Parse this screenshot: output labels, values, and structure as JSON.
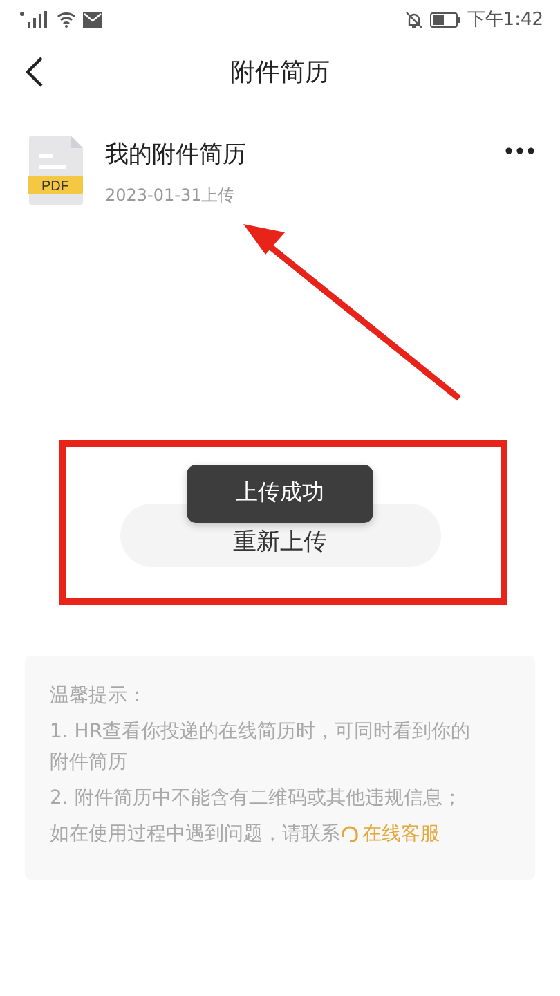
{
  "status_bar": {
    "time": "下午1:42"
  },
  "nav": {
    "title": "附件简历"
  },
  "file": {
    "type_label": "PDF",
    "name": "我的附件简历",
    "meta": "2023-01-31上传"
  },
  "reupload_button": {
    "label": "重新上传"
  },
  "toast": {
    "text": "上传成功"
  },
  "tips": {
    "heading": "温馨提示：",
    "items": [
      "1. HR查看你投递的在线简历时，可同时看到你的附件简历",
      "2. 附件简历中不能含有二维码或其他违规信息；"
    ],
    "contact": "如在使用过程中遇到问题，请联系",
    "link": "在线客服"
  }
}
